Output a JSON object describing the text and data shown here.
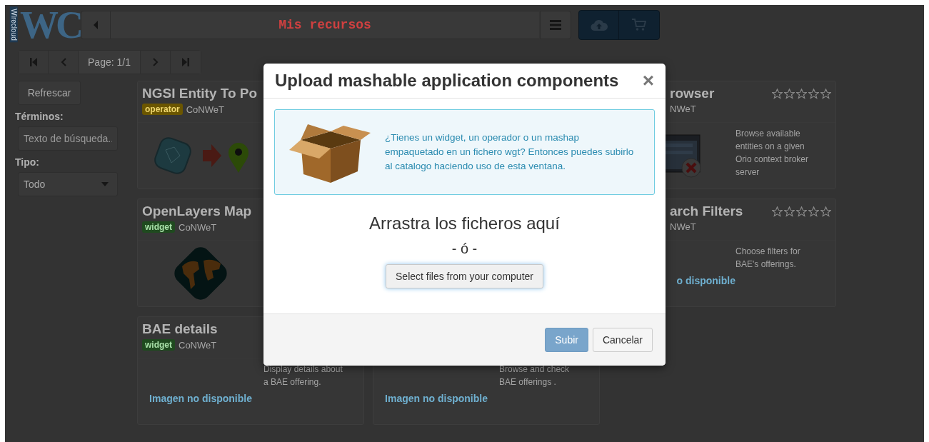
{
  "header": {
    "logo_letters": "WC",
    "logo_caption": "Wirecloud",
    "title": "Mis recursos"
  },
  "pagination": {
    "page_label": "Page: 1/1"
  },
  "sidebar": {
    "refresh_button": "Refrescar",
    "terms_label": "Términos:",
    "search": {
      "placeholder": "Texto de búsqueda.."
    },
    "type_label": "Tipo:",
    "type_select": {
      "value": "Todo"
    }
  },
  "rows": [
    {
      "cards": [
        {
          "kind": "cut_right",
          "title": "NGSI Entity To Po",
          "type": "operator",
          "vendor": "CoNWeT",
          "image": {
            "kind": "entity_pin"
          }
        },
        {
          "kind": "cut_left",
          "title": "rowser",
          "vendor": "NWeT",
          "stars": 0,
          "description": "Browse available entities on a given Orio context broker server",
          "image": {
            "kind": "browser_window"
          }
        }
      ]
    },
    {
      "cards": [
        {
          "kind": "cut_right",
          "title": "OpenLayers Map",
          "type": "widget",
          "vendor": "CoNWeT",
          "image": {
            "kind": "globe"
          }
        },
        {
          "kind": "cut_left",
          "title": "arch Filters",
          "vendor": "NWeT",
          "stars": 0,
          "description": "Choose filters for BAE's offerings.",
          "image": {
            "kind": "none",
            "text": "o disponible"
          }
        }
      ]
    },
    {
      "cards": [
        {
          "kind": "full",
          "title": "BAE details",
          "type": "widget",
          "vendor": "CoNWeT",
          "description": "Display details about a BAE offering.",
          "image": {
            "kind": "none",
            "text": "Imagen no disponible"
          }
        },
        {
          "kind": "cut_top",
          "description": "Browse and check BAE offerings .",
          "image": {
            "kind": "none",
            "text": "Imagen no disponible"
          }
        }
      ]
    }
  ],
  "modal": {
    "title": "Upload mashable application components",
    "close": "×",
    "info": "¿Tienes un widget, un operador o un mashap empaquetado en un fichero wgt? Entonces puedes subirlo al catalogo haciendo uso de esta ventana.",
    "drop_text": "Arrastra los ficheros aquí",
    "or_text": "- ó -",
    "select_button": "Select files from your computer",
    "buttons": [
      {
        "label": "Subir",
        "kind": "primary",
        "disabled": true
      },
      {
        "label": "Cancelar",
        "kind": "default",
        "disabled": false
      }
    ]
  }
}
